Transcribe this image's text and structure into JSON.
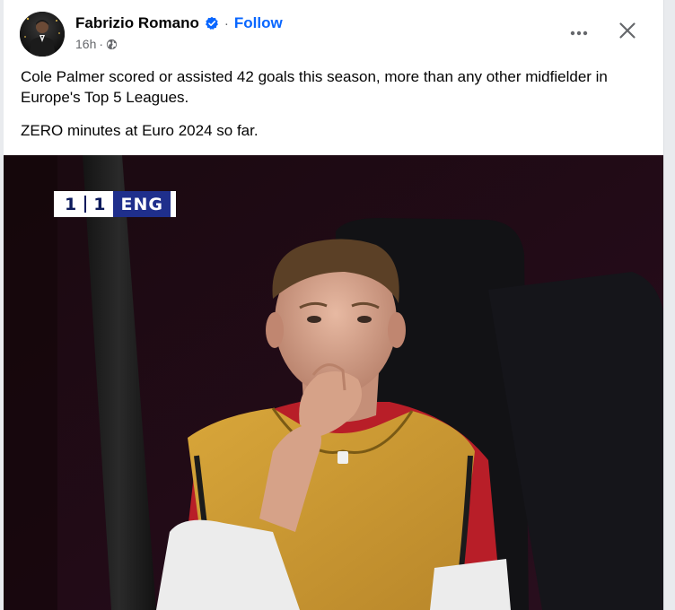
{
  "post": {
    "author_name": "Fabrizio Romano",
    "follow_label": "Follow",
    "separator": "·",
    "timestamp": "16h",
    "meta_separator": "·",
    "audience_icon": "globe-icon",
    "verified_icon": "verified-badge-icon",
    "more_icon": "more-options-icon",
    "close_icon": "close-icon",
    "paragraphs": [
      "Cole Palmer scored or assisted 42 goals this season, more than any other midfielder in Europe's Top 5 Leagues.",
      "ZERO minutes at Euro 2024 so far."
    ]
  },
  "image": {
    "scoreboard": {
      "score_left": "1",
      "score_right": "1",
      "team": "ENG"
    }
  },
  "colors": {
    "accent": "#0866ff",
    "text_primary": "#050505",
    "text_secondary": "#65676b",
    "card_background": "#ffffff",
    "page_background": "#e9ebee"
  }
}
